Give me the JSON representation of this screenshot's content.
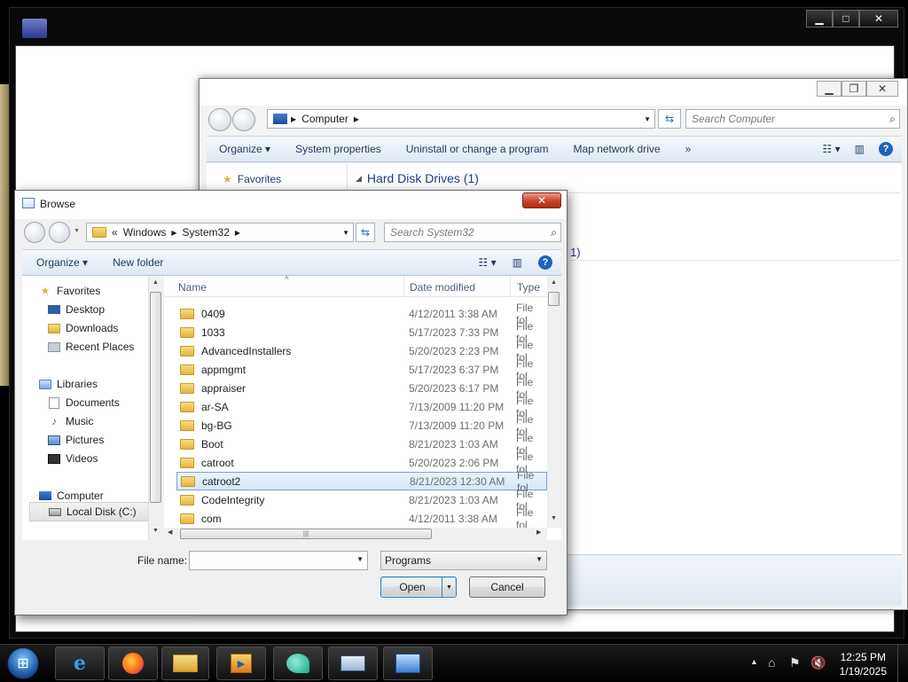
{
  "background_window": {
    "caption_buttons": [
      "▁",
      "□",
      "✕"
    ]
  },
  "explorer": {
    "address_parts": [
      "Computer"
    ],
    "search_placeholder": "Search Computer",
    "commands": [
      "Organize ▾",
      "System properties",
      "Uninstall or change a program",
      "Map network drive",
      "»"
    ],
    "favorites_label": "Favorites",
    "section_title": "Hard Disk Drives (1)",
    "section2_partial": "1)"
  },
  "browse": {
    "title": "Browse",
    "close_label": "✕",
    "address_prefix": "«",
    "address_parts": [
      "Windows",
      "System32"
    ],
    "search_placeholder": "Search System32",
    "organize_label": "Organize ▾",
    "new_folder_label": "New folder",
    "nav": {
      "favorites": "Favorites",
      "desktop": "Desktop",
      "downloads": "Downloads",
      "recent_places": "Recent Places",
      "libraries": "Libraries",
      "documents": "Documents",
      "music": "Music",
      "pictures": "Pictures",
      "videos": "Videos",
      "computer": "Computer",
      "local_disk": "Local Disk (C:)"
    },
    "columns": {
      "name": "Name",
      "date": "Date modified",
      "type": "Type"
    },
    "files": [
      {
        "name": "0409",
        "date": "4/12/2011 3:38 AM",
        "type": "File fol"
      },
      {
        "name": "1033",
        "date": "5/17/2023 7:33 PM",
        "type": "File fol"
      },
      {
        "name": "AdvancedInstallers",
        "date": "5/20/2023 2:23 PM",
        "type": "File fol"
      },
      {
        "name": "appmgmt",
        "date": "5/17/2023 6:37 PM",
        "type": "File fol"
      },
      {
        "name": "appraiser",
        "date": "5/20/2023 6:17 PM",
        "type": "File fol"
      },
      {
        "name": "ar-SA",
        "date": "7/13/2009 11:20 PM",
        "type": "File fol"
      },
      {
        "name": "bg-BG",
        "date": "7/13/2009 11:20 PM",
        "type": "File fol"
      },
      {
        "name": "Boot",
        "date": "8/21/2023 1:03 AM",
        "type": "File fol"
      },
      {
        "name": "catroot",
        "date": "5/20/2023 2:06 PM",
        "type": "File fol"
      },
      {
        "name": "catroot2",
        "date": "8/21/2023 12:30 AM",
        "type": "File fol"
      },
      {
        "name": "CodeIntegrity",
        "date": "8/21/2023 1:03 AM",
        "type": "File fol"
      },
      {
        "name": "com",
        "date": "4/12/2011 3:38 AM",
        "type": "File fol"
      }
    ],
    "selected_file": "catroot2",
    "filename_label": "File name:",
    "filename_value": "",
    "filetype_value": "Programs",
    "open_label": "Open",
    "cancel_label": "Cancel"
  },
  "taskbar": {
    "time": "12:25 PM",
    "date": "1/19/2025"
  }
}
